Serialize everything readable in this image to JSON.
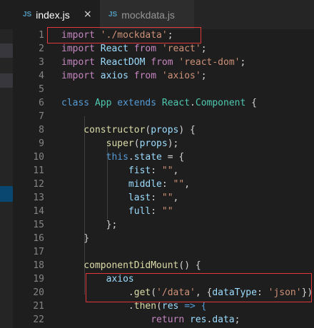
{
  "tabs": [
    {
      "icon": "JS",
      "label": "index.js",
      "active": true,
      "close": "×"
    },
    {
      "icon": "JS",
      "label": "mockdata.js",
      "active": false
    }
  ],
  "line_numbers": [
    "1",
    "2",
    "3",
    "4",
    "5",
    "6",
    "7",
    "8",
    "9",
    "10",
    "11",
    "12",
    "13",
    "14",
    "15",
    "16",
    "17",
    "18",
    "19",
    "20",
    "21",
    "22"
  ],
  "code": {
    "l1": {
      "a": "import",
      "b": " './mockdata'",
      ";": ";"
    },
    "l2": {
      "a": "import",
      "b": " React ",
      "c": "from",
      "d": " 'react'",
      "e": ";"
    },
    "l3": {
      "a": "import",
      "b": " ReactDOM ",
      "c": "from",
      "d": " 'react-dom'",
      "e": ";"
    },
    "l4": {
      "a": "import",
      "b": " axios ",
      "c": "from",
      "d": " 'axios'",
      "e": ";"
    },
    "l6": {
      "a": "class",
      "b": " App ",
      "c": "extends",
      "d": " React",
      "e": ".",
      "f": "Component",
      "g": " {"
    },
    "l8": {
      "a": "    constructor",
      "b": "(",
      "c": "props",
      "d": ") {"
    },
    "l9": {
      "a": "        super",
      "b": "(",
      "c": "props",
      "d": ");"
    },
    "l10": {
      "a": "        this",
      "b": ".",
      "c": "state",
      "d": " = {"
    },
    "l11": {
      "a": "            fist",
      "b": ": ",
      "c": "\"\"",
      "d": ","
    },
    "l12": {
      "a": "            middle",
      "b": ": ",
      "c": "\"\"",
      "d": ","
    },
    "l13": {
      "a": "            last",
      "b": ": ",
      "c": "\"\"",
      "d": ","
    },
    "l14": {
      "a": "            full",
      "b": ": ",
      "c": "\"\""
    },
    "l15": "        };",
    "l16": "    }",
    "l18": {
      "a": "    componentDidMount",
      "b": "() {"
    },
    "l19": {
      "a": "        axios"
    },
    "l20": {
      "a": "            .",
      "b": "get",
      "c": "(",
      "d": "'/data'",
      "e": ", {",
      "f": "dataType",
      "g": ": ",
      "h": "'json'",
      "i": "})"
    },
    "l21": {
      "a": "            .",
      "b": "then",
      "c": "(",
      "d": "res",
      "e": " => {"
    },
    "l22": {
      "a": "                return",
      "b": " res",
      "c": ".",
      "d": "data",
      "e": ";"
    }
  }
}
